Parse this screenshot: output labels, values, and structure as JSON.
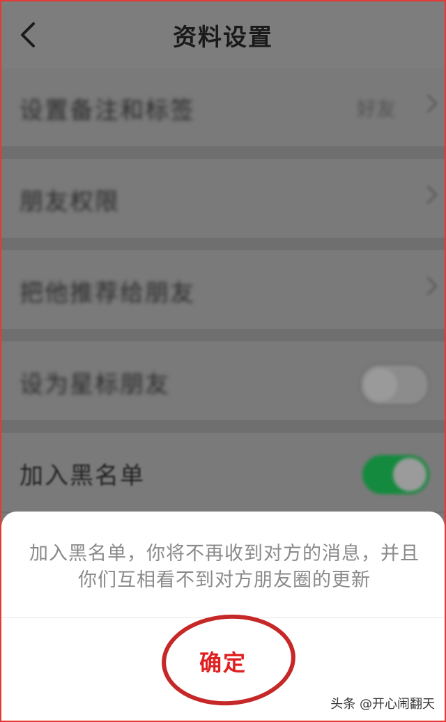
{
  "header": {
    "title": "资料设置",
    "back_icon": "chevron-left-icon"
  },
  "rows": [
    {
      "label": "设置备注和标签",
      "value": "好友",
      "control": "chevron"
    },
    {
      "label": "朋友权限",
      "control": "chevron"
    },
    {
      "label": "把他推荐给朋友",
      "control": "chevron"
    },
    {
      "label": "设为星标朋友",
      "control": "toggle-off"
    },
    {
      "label": "加入黑名单",
      "control": "toggle-on"
    }
  ],
  "sheet": {
    "message": "加入黑名单，你将不再收到对方的消息，并且你们互相看不到对方朋友圈的更新",
    "confirm_label": "确定"
  },
  "watermark": "头条 @开心闹翻天",
  "colors": {
    "confirm_text": "#e02020",
    "toggle_on": "#148a3e",
    "annotation": "#c62828"
  }
}
